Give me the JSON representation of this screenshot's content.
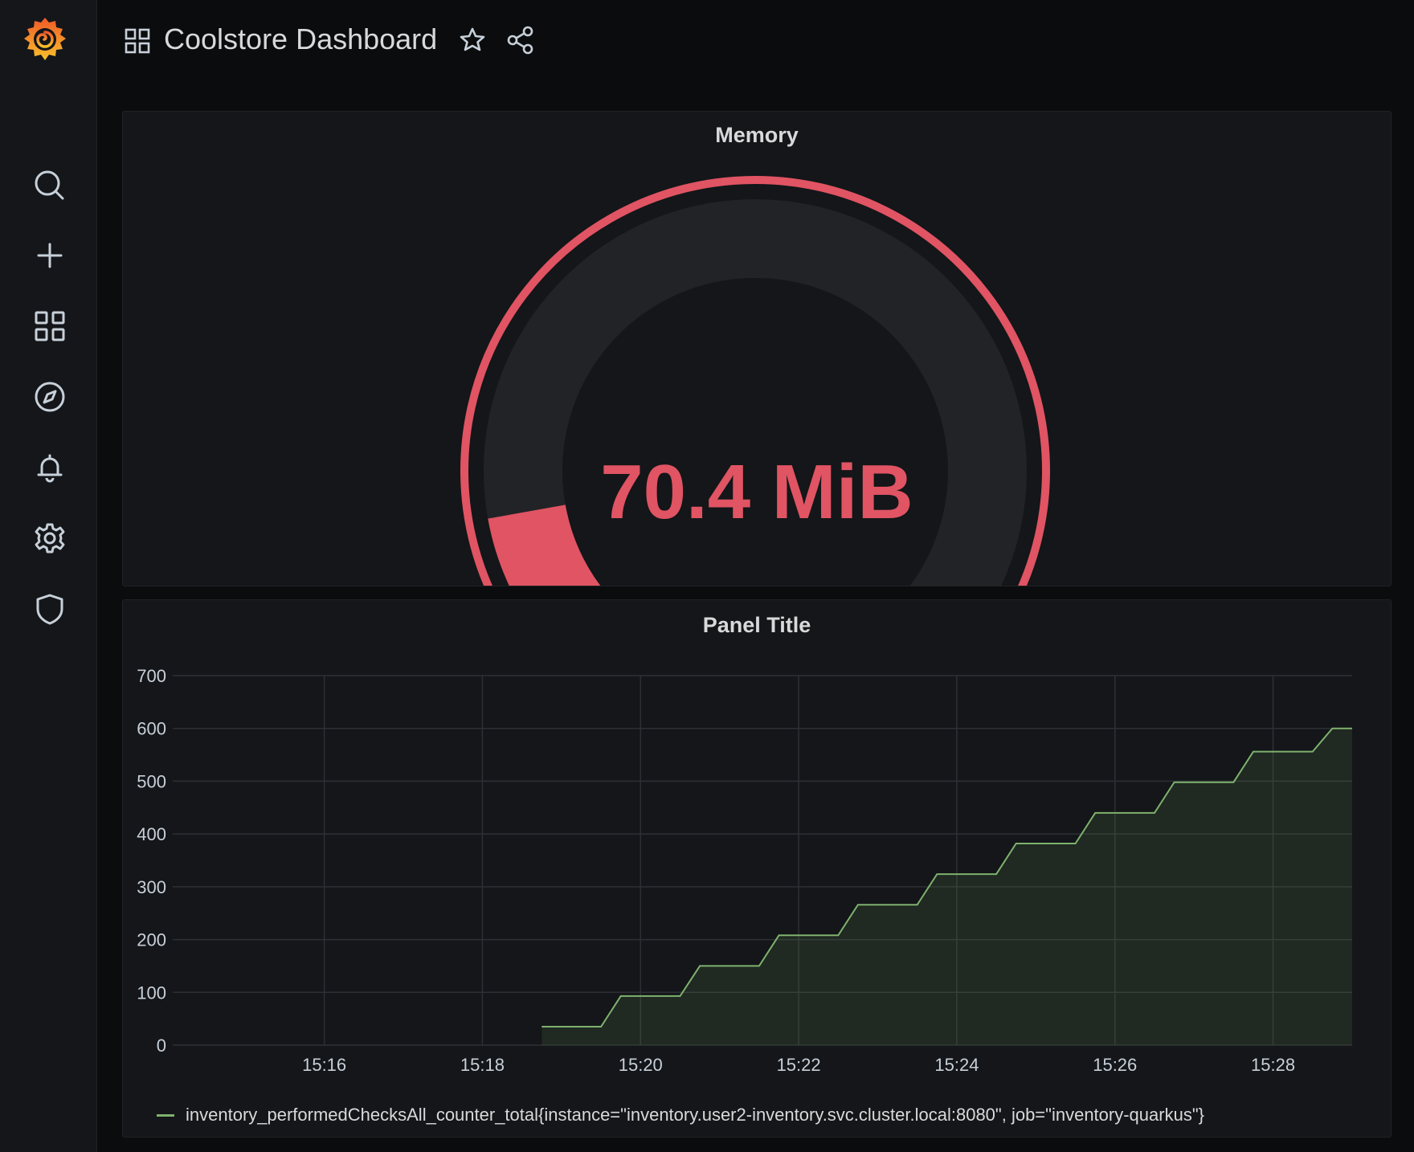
{
  "header": {
    "title": "Coolstore Dashboard"
  },
  "sidebar": {
    "items": [
      {
        "icon": "search-icon"
      },
      {
        "icon": "plus-icon"
      },
      {
        "icon": "dashboards-icon"
      },
      {
        "icon": "compass-icon"
      },
      {
        "icon": "bell-icon"
      },
      {
        "icon": "gear-icon"
      },
      {
        "icon": "shield-icon"
      }
    ]
  },
  "colors": {
    "gauge": "#e05463",
    "gauge_track": "#222326",
    "series": "#7eb26d",
    "logo": "#f48b2a"
  },
  "gauge_panel": {
    "title": "Memory",
    "value": "70.4 MiB",
    "fill_fraction": 0.18
  },
  "graph_panel": {
    "title": "Panel Title",
    "legend": "inventory_performedChecksAll_counter_total{instance=\"inventory.user2-inventory.svc.cluster.local:8080\", job=\"inventory-quarkus\"}"
  },
  "chart_data": {
    "type": "line",
    "title": "Panel Title",
    "xlabel": "",
    "ylabel": "",
    "ylim": [
      0,
      700
    ],
    "y_ticks": [
      "0",
      "100",
      "200",
      "300",
      "400",
      "500",
      "600",
      "700"
    ],
    "x_ticks": [
      "15:16",
      "15:18",
      "15:20",
      "15:22",
      "15:24",
      "15:26",
      "15:28"
    ],
    "grid": true,
    "series": [
      {
        "name": "inventory_performedChecksAll_counter_total{instance=\"inventory.user2-inventory.svc.cluster.local:8080\", job=\"inventory-quarkus\"}",
        "points": [
          [
            "15:18:45",
            35
          ],
          [
            "15:19:30",
            35
          ],
          [
            "15:19:45",
            93
          ],
          [
            "15:20:30",
            93
          ],
          [
            "15:20:45",
            150
          ],
          [
            "15:21:30",
            150
          ],
          [
            "15:21:45",
            208
          ],
          [
            "15:22:30",
            208
          ],
          [
            "15:22:45",
            266
          ],
          [
            "15:23:30",
            266
          ],
          [
            "15:23:45",
            324
          ],
          [
            "15:24:30",
            324
          ],
          [
            "15:24:45",
            382
          ],
          [
            "15:25:30",
            382
          ],
          [
            "15:25:45",
            440
          ],
          [
            "15:26:30",
            440
          ],
          [
            "15:26:45",
            498
          ],
          [
            "15:27:30",
            498
          ],
          [
            "15:27:45",
            556
          ],
          [
            "15:28:30",
            556
          ],
          [
            "15:28:45",
            600
          ],
          [
            "15:29:00",
            600
          ]
        ]
      }
    ]
  }
}
